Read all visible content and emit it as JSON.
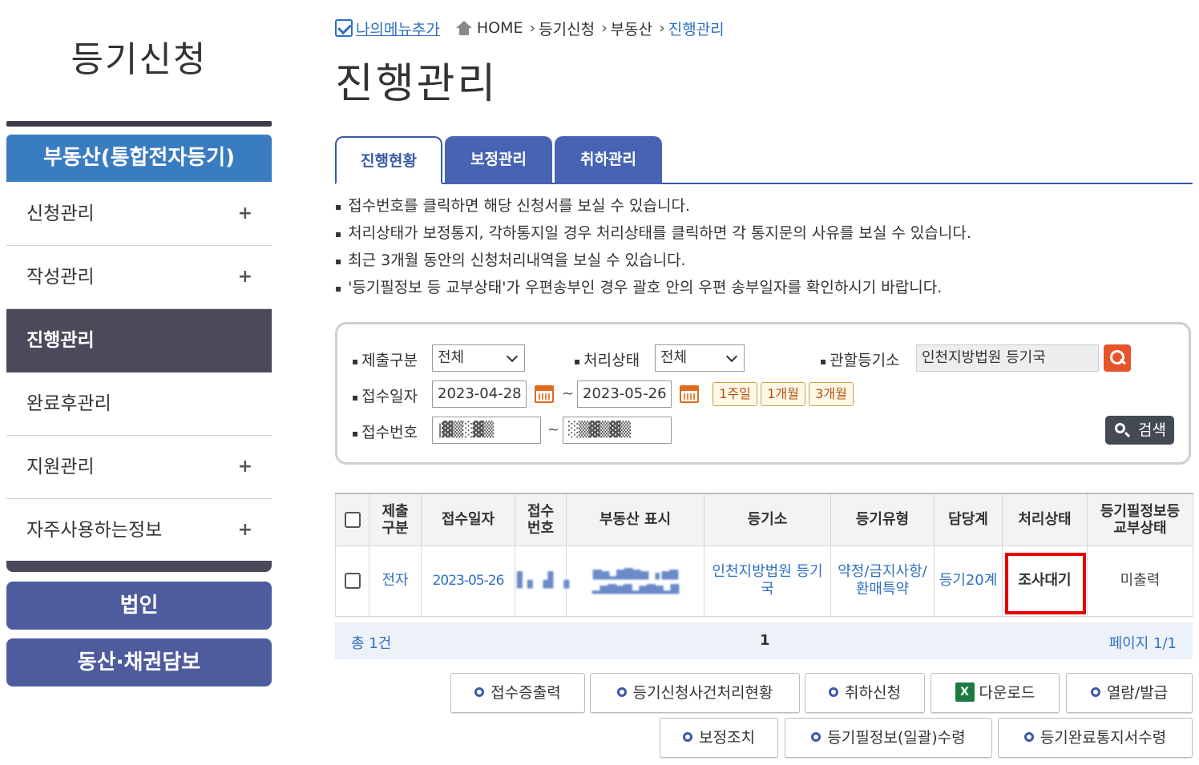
{
  "sidebar": {
    "title": "등기신청",
    "section": "부동산(통합전자등기)",
    "items": [
      {
        "label": "신청관리",
        "plus": "+"
      },
      {
        "label": "작성관리",
        "plus": "+"
      },
      {
        "label": "진행관리",
        "plus": ""
      },
      {
        "label": "완료후관리",
        "plus": ""
      },
      {
        "label": "지원관리",
        "plus": "+"
      },
      {
        "label": "자주사용하는정보",
        "plus": "+"
      }
    ],
    "corp_label": "법인",
    "movable_label": "동산·채권담보"
  },
  "breadcrumb": {
    "my_menu": "나의메뉴추가",
    "home": "HOME",
    "sep": "›",
    "c1": "등기신청",
    "c2": "부동산",
    "current": "진행관리"
  },
  "page_title": "진행관리",
  "tabs": [
    "진행현황",
    "보정관리",
    "취하관리"
  ],
  "notices": [
    "접수번호를 클릭하면 해당 신청서를 보실 수 있습니다.",
    "처리상태가 보정통지, 각하통지일 경우 처리상태를 클릭하면 각 통지문의 사유를 보실 수 있습니다.",
    "최근 3개월 동안의 신청처리내역을 보실 수 있습니다.",
    "'등기필정보 등 교부상태'가 우편송부인 경우 괄호 안의 우편 송부일자를 확인하시기 바랍니다."
  ],
  "search": {
    "submit_type_label": "제출구분",
    "submit_type_value": "전체",
    "status_label": "처리상태",
    "status_value": "전체",
    "office_label": "관할등기소",
    "office_value": "인천지방법원 등기국",
    "date_label": "접수일자",
    "date_from": "2023-04-28",
    "date_to": "2023-05-26",
    "tilde": "~",
    "period_1w": "1주일",
    "period_1m": "1개월",
    "period_3m": "3개월",
    "number_label": "접수번호",
    "number_from": "|▓▒░▓▒",
    "number_to": "░▒▓▒▓▒",
    "search_button": "검색"
  },
  "table": {
    "headers": [
      "",
      "제출\n구분",
      "접수일자",
      "접수\n번호",
      "부동산 표시",
      "등기소",
      "등기유형",
      "담당계",
      "처리상태",
      "등기필정보등\n교부상태"
    ],
    "row": {
      "submit_type": "전자",
      "date": "2023-05-26",
      "number": "▌▖▗▌▗",
      "property": "▆▅▂▆▇▆▅ ▗ ▅▆ ▂▅▆▅▆▂▅▆▅▂▆",
      "office": "인천지방법원 등기국",
      "reg_type": "약정/금지사항/환매특약",
      "team": "등기20계",
      "status": "조사대기",
      "issue_status": "미출력"
    },
    "total": "총 1건",
    "page": "1",
    "page_info": "페이지 1/1"
  },
  "actions": {
    "receipt_print": "접수증출력",
    "case_status": "등기신청사건처리현황",
    "withdraw": "취하신청",
    "download": "다운로드",
    "view_issue": "열람/발급",
    "correction": "보정조치",
    "cert_receive": "등기필정보(일괄)수령",
    "completion_notice": "등기완료통지서수령"
  },
  "colors": {
    "accent_blue": "#3a7cc0",
    "tab_blue": "#4764b4",
    "sidebar_dark": "#4a4a5a",
    "sidebar_btn": "#4e5c9e",
    "highlight_red": "#e60000",
    "search_orange": "#e8542a"
  }
}
